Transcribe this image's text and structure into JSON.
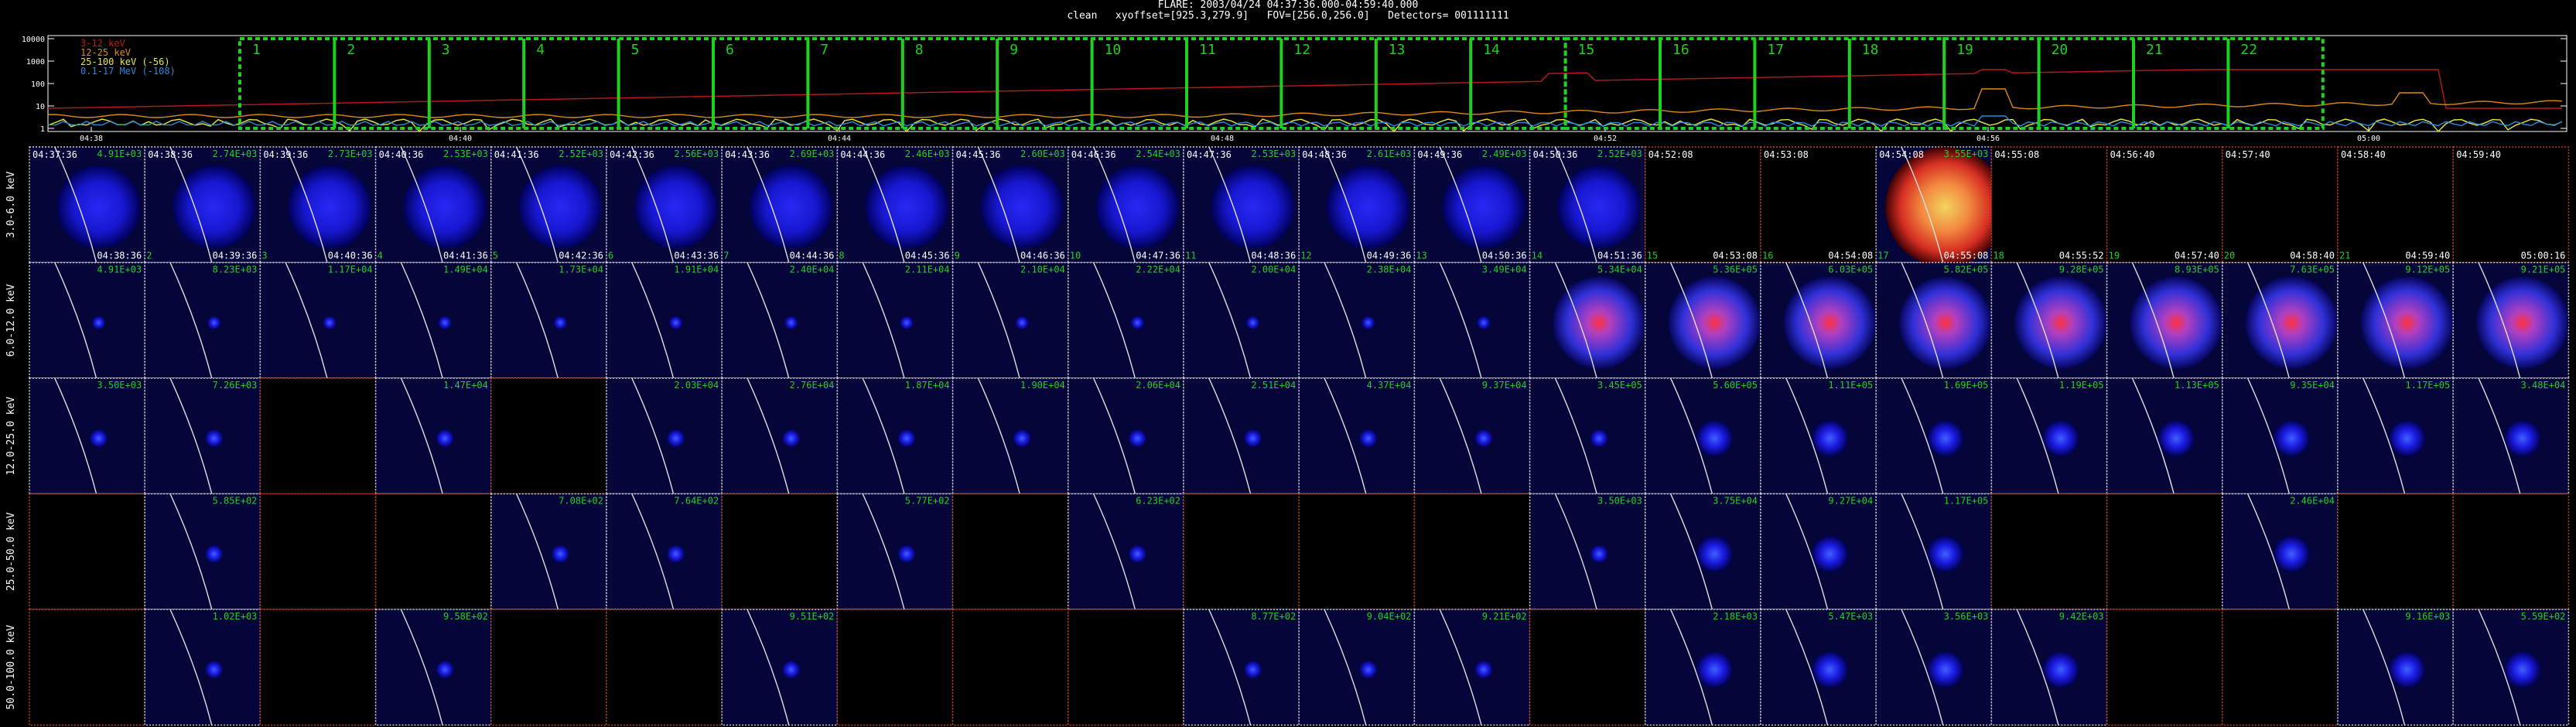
{
  "header": {
    "line1": "FLARE: 2003/04/24 04:37:36.000-04:59:40.000",
    "line2": "clean   xyoffset=[925.3,279.9]   FOV=[256.0,256.0]   Detectors= 001111111"
  },
  "lightcurve": {
    "y_ticks": [
      "10000",
      "1000",
      "100",
      "10",
      "1"
    ],
    "x_ticks": [
      "04:38",
      "04:40",
      "04:44",
      "04:48",
      "04:52",
      "04:56",
      "05:00"
    ],
    "legend": [
      {
        "label": "3-12 keV",
        "color": "#c01818"
      },
      {
        "label": "12-25 keV",
        "color": "#e08a10"
      },
      {
        "label": "25-100 keV (-56)",
        "color": "#e8e840"
      },
      {
        "label": "0.1-17 MeV (-108)",
        "color": "#2a8ae0"
      }
    ],
    "intervals": [
      "1",
      "2",
      "3",
      "4",
      "5",
      "6",
      "7",
      "8",
      "9",
      "10",
      "11",
      "12",
      "13",
      "14",
      "15",
      "16",
      "17",
      "18",
      "19",
      "20",
      "21",
      "22"
    ],
    "box_color": "#20d020"
  },
  "grid": {
    "row_labels": [
      "3.0-6.0 keV",
      "6.0-12.0 keV",
      "12.0-25.0 keV",
      "25.0-50.0 keV",
      "50.0-100.0 keV"
    ],
    "start_times": [
      "04:37:36",
      "04:38:36",
      "04:39:36",
      "04:40:36",
      "04:41:36",
      "04:42:36",
      "04:43:36",
      "04:44:36",
      "04:45:36",
      "04:46:36",
      "04:47:36",
      "04:48:36",
      "04:49:36",
      "04:50:36",
      "04:52:08",
      "04:53:08",
      "04:54:08",
      "04:55:08",
      "04:56:40",
      "04:57:40",
      "04:58:40",
      "04:59:40"
    ],
    "end_times": [
      "04:38:36",
      "04:39:36",
      "04:40:36",
      "04:41:36",
      "04:42:36",
      "04:43:36",
      "04:44:36",
      "04:45:36",
      "04:46:36",
      "04:47:36",
      "04:48:36",
      "04:49:36",
      "04:50:36",
      "04:51:36",
      "04:53:08",
      "04:54:08",
      "04:55:08",
      "04:55:52",
      "04:57:40",
      "04:58:40",
      "04:59:40",
      "05:00:16"
    ],
    "counts": [
      [
        "4.91E+03",
        "2.74E+03",
        "2.73E+03",
        "2.53E+03",
        "2.52E+03",
        "2.56E+03",
        "2.69E+03",
        "2.46E+03",
        "2.60E+03",
        "2.54E+03",
        "2.53E+03",
        "2.61E+03",
        "2.49E+03",
        "2.52E+03",
        "",
        "",
        "3.55E+03",
        "",
        "",
        "",
        "",
        ""
      ],
      [
        "4.91E+03",
        "8.23E+03",
        "1.17E+04",
        "1.49E+04",
        "1.73E+04",
        "1.91E+04",
        "2.40E+04",
        "2.11E+04",
        "2.10E+04",
        "2.22E+04",
        "2.00E+04",
        "2.38E+04",
        "3.49E+04",
        "5.34E+04",
        "5.36E+05",
        "6.03E+05",
        "5.82E+05",
        "9.28E+05",
        "8.93E+05",
        "7.63E+05",
        "9.12E+05",
        "9.21E+05"
      ],
      [
        "3.50E+03",
        "7.26E+03",
        "",
        "1.47E+04",
        "",
        "2.03E+04",
        "2.76E+04",
        "1.87E+04",
        "1.90E+04",
        "2.06E+04",
        "2.51E+04",
        "4.37E+04",
        "9.37E+04",
        "3.45E+05",
        "5.60E+05",
        "1.11E+05",
        "1.69E+05",
        "1.19E+05",
        "1.13E+05",
        "9.35E+04",
        "1.17E+05",
        "3.48E+04"
      ],
      [
        "",
        "5.85E+02",
        "",
        "",
        "7.08E+02",
        "7.64E+02",
        "",
        "5.77E+02",
        "",
        "6.23E+02",
        "",
        "",
        "",
        "3.50E+03",
        "3.75E+04",
        "9.27E+04",
        "1.17E+05",
        "",
        "",
        "2.46E+04",
        "",
        ""
      ],
      [
        "",
        "1.02E+03",
        "",
        "9.58E+02",
        "",
        "",
        "9.51E+02",
        "",
        "",
        "",
        "8.77E+02",
        "9.04E+02",
        "9.21E+02",
        "",
        "2.18E+03",
        "5.47E+03",
        "3.56E+03",
        "9.42E+03",
        "",
        "",
        "9.16E+03",
        "5.59E+02"
      ]
    ],
    "cell_index_labels": [
      "",
      "2",
      "3",
      "4",
      "5",
      "6",
      "7",
      "8",
      "9",
      "10",
      "11",
      "12",
      "13",
      "14",
      "15",
      "16",
      "17",
      "18",
      "19",
      "20",
      "21",
      ""
    ]
  }
}
